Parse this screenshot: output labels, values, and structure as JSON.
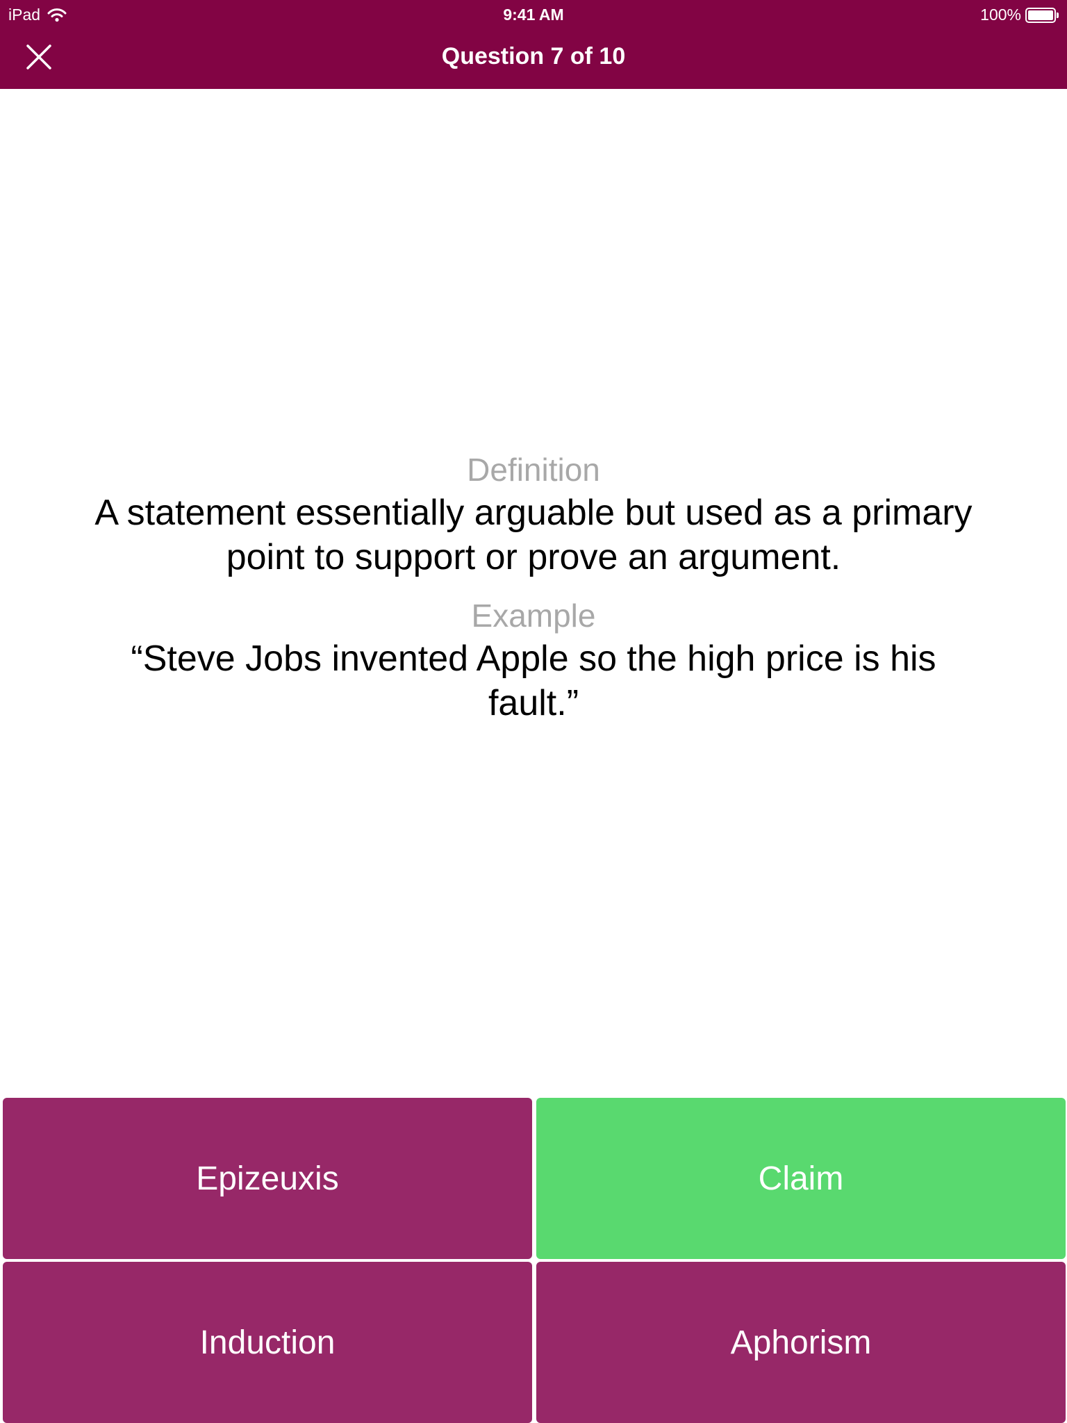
{
  "status_bar": {
    "device": "iPad",
    "time": "9:41 AM",
    "battery": "100%",
    "battery_level": 1.0,
    "icons": [
      "wifi-icon",
      "battery-icon"
    ]
  },
  "nav": {
    "title": "Question 7 of 10",
    "close_icon": "close-icon"
  },
  "question": {
    "definition_label": "Definition",
    "definition_text": "A statement essentially arguable but used as a primary point to support or prove an argument.",
    "example_label": "Example",
    "example_text": "“Steve Jobs invented Apple so the high price is his fault.”"
  },
  "answers": [
    {
      "label": "Epizeuxis",
      "state": "default"
    },
    {
      "label": "Claim",
      "state": "correct"
    },
    {
      "label": "Induction",
      "state": "default"
    },
    {
      "label": "Aphorism",
      "state": "default"
    }
  ],
  "colors": {
    "brand": "#820444",
    "answer_default": "#972868",
    "answer_correct": "#59d96f",
    "label_gray": "#a8a8a8"
  }
}
